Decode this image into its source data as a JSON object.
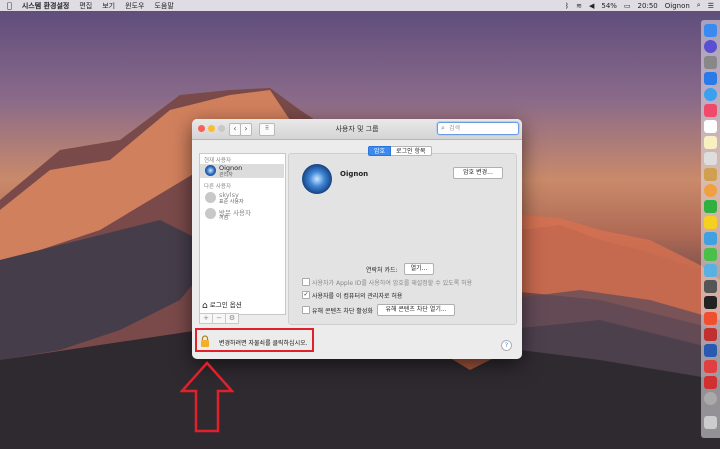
{
  "menubar": {
    "app": "시스템 환경설정",
    "items": [
      "편집",
      "보기",
      "윈도우",
      "도움말"
    ],
    "battery": "54%",
    "time": "20:50",
    "user": "Oignon"
  },
  "window": {
    "title": "사용자 및 그룹",
    "search_placeholder": "검색"
  },
  "sidebar": {
    "current_users_header": "현재 사용자",
    "current_user": {
      "name": "Oignon",
      "role": "관리자"
    },
    "other_users_header": "다른 사용자",
    "other_users": [
      {
        "name": "skylsy",
        "role": "표준 사용자"
      },
      {
        "name": "방문 사용자",
        "role": "꺼짐"
      }
    ],
    "login_options": "로그인 옵션"
  },
  "tabs": [
    "암호",
    "로그인 항목"
  ],
  "main": {
    "user_name": "Oignon",
    "change_password": "암호 변경...",
    "contacts_card_label": "연락처 카드:",
    "open_button": "열기...",
    "option_apple_id": "사용자가 Apple ID를 사용하여 암호를 재설정할 수 있도록 허용",
    "option_admin": "사용자를 이 컴퓨터의 관리자로 허용",
    "option_parental": "유해 콘텐츠 차단 활성화",
    "parental_button": "유해 콘텐츠 차단 열기..."
  },
  "lock": {
    "text": "변경하려면 자물쇠를 클릭하십시오."
  },
  "colors": {
    "highlight": "#e0202a",
    "accent": "#3c8af0"
  }
}
